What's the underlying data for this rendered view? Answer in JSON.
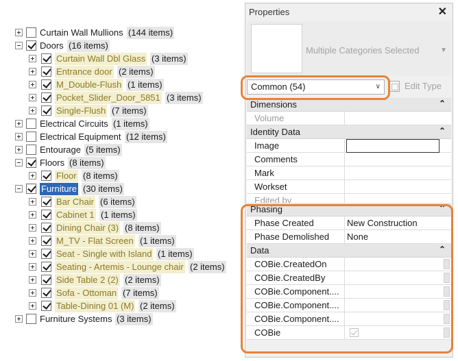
{
  "tree": {
    "items": [
      {
        "label": "Curtain Wall Mullions",
        "count": "(144 items)",
        "level": 0,
        "expander": "plus",
        "checked": false,
        "style": "normal"
      },
      {
        "label": "Doors",
        "count": "(16 items)",
        "level": 0,
        "expander": "minus",
        "checked": true,
        "style": "normal"
      },
      {
        "label": "Curtain Wall Dbl Glass",
        "count": "(3 items)",
        "level": 1,
        "expander": "plus",
        "checked": true,
        "style": "sub"
      },
      {
        "label": "Entrance door",
        "count": "(2 items)",
        "level": 1,
        "expander": "plus",
        "checked": true,
        "style": "sub"
      },
      {
        "label": "M_Double-Flush",
        "count": "(1 items)",
        "level": 1,
        "expander": "plus",
        "checked": true,
        "style": "sub"
      },
      {
        "label": "Pocket_Slider_Door_5851",
        "count": "(3 items)",
        "level": 1,
        "expander": "plus",
        "checked": true,
        "style": "sub"
      },
      {
        "label": "Single-Flush",
        "count": "(7 items)",
        "level": 1,
        "expander": "plus",
        "checked": true,
        "style": "sub"
      },
      {
        "label": "Electrical Circuits",
        "count": "(1 items)",
        "level": 0,
        "expander": "plus",
        "checked": false,
        "style": "normal"
      },
      {
        "label": "Electrical Equipment",
        "count": "(12 items)",
        "level": 0,
        "expander": "plus",
        "checked": false,
        "style": "normal"
      },
      {
        "label": "Entourage",
        "count": "(5 items)",
        "level": 0,
        "expander": "plus",
        "checked": false,
        "style": "normal"
      },
      {
        "label": "Floors",
        "count": "(8 items)",
        "level": 0,
        "expander": "minus",
        "checked": true,
        "style": "normal"
      },
      {
        "label": "Floor",
        "count": "(8 items)",
        "level": 1,
        "expander": "plus",
        "checked": true,
        "style": "sub"
      },
      {
        "label": "Furniture",
        "count": "(30 items)",
        "level": 0,
        "expander": "minus",
        "checked": true,
        "style": "selected"
      },
      {
        "label": "Bar Chair",
        "count": "(6 items)",
        "level": 1,
        "expander": "plus",
        "checked": true,
        "style": "sub"
      },
      {
        "label": "Cabinet 1",
        "count": "(1 items)",
        "level": 1,
        "expander": "plus",
        "checked": true,
        "style": "sub"
      },
      {
        "label": "Dining Chair (3)",
        "count": "(8 items)",
        "level": 1,
        "expander": "plus",
        "checked": true,
        "style": "sub"
      },
      {
        "label": "M_TV - Flat Screen",
        "count": "(1 items)",
        "level": 1,
        "expander": "plus",
        "checked": true,
        "style": "sub"
      },
      {
        "label": "Seat - Single with Island",
        "count": "(1 items)",
        "level": 1,
        "expander": "plus",
        "checked": true,
        "style": "sub"
      },
      {
        "label": "Seating - Artemis - Lounge chair",
        "count": "(2 items)",
        "level": 1,
        "expander": "plus",
        "checked": true,
        "style": "sub"
      },
      {
        "label": "Side Table 2 (2)",
        "count": "(2 items)",
        "level": 1,
        "expander": "plus",
        "checked": true,
        "style": "sub"
      },
      {
        "label": "Sofa - Ottoman",
        "count": "(7 items)",
        "level": 1,
        "expander": "plus",
        "checked": true,
        "style": "sub"
      },
      {
        "label": "Table-Dining 01 (M)",
        "count": "(2 items)",
        "level": 1,
        "expander": "plus",
        "checked": true,
        "style": "sub"
      },
      {
        "label": "Furniture Systems",
        "count": "(3 items)",
        "level": 0,
        "expander": "plus",
        "checked": false,
        "style": "normal"
      }
    ]
  },
  "properties": {
    "title": "Properties",
    "close_icon": "close-icon",
    "type_selector": "Multiple Categories Selected",
    "filter": "Common (54)",
    "edit_type": "Edit Type",
    "sections": [
      {
        "name": "Dimensions",
        "rows": [
          {
            "name": "Volume",
            "value": "",
            "dim": true
          }
        ]
      },
      {
        "name": "Identity Data",
        "rows": [
          {
            "name": "Image",
            "value": "",
            "boxed": true
          },
          {
            "name": "Comments",
            "value": ""
          },
          {
            "name": "Mark",
            "value": ""
          },
          {
            "name": "Workset",
            "value": ""
          },
          {
            "name": "Edited by",
            "value": "",
            "dim": true,
            "partial": true
          }
        ]
      },
      {
        "name": "Phasing",
        "rows": [
          {
            "name": "Phase Created",
            "value": "New Construction"
          },
          {
            "name": "Phase Demolished",
            "value": "None"
          }
        ]
      },
      {
        "name": "Data",
        "rows": [
          {
            "name": "COBie.CreatedOn",
            "value": "",
            "stub": true
          },
          {
            "name": "COBie.CreatedBy",
            "value": "",
            "stub": true
          },
          {
            "name": "COBie.Component....",
            "value": "",
            "stub": true
          },
          {
            "name": "COBie.Component....",
            "value": "",
            "stub": true
          },
          {
            "name": "COBie.Component....",
            "value": "",
            "stub": true
          },
          {
            "name": "COBie",
            "value": "",
            "check": true,
            "stub": true
          }
        ]
      }
    ]
  },
  "colors": {
    "highlight": "#e8823a",
    "selection": "#2d67b8",
    "subtype_text": "#8a7a2a",
    "subtype_bg": "#f3efcf"
  }
}
